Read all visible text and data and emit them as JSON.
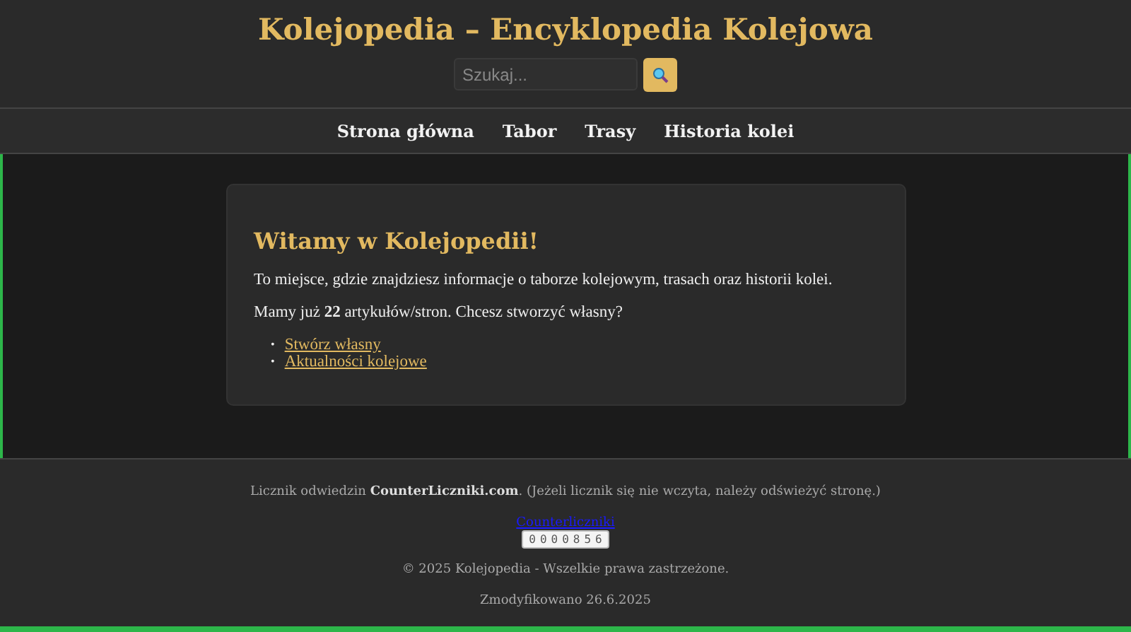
{
  "header": {
    "title": "Kolejopedia – Encyklopedia Kolejowa",
    "search": {
      "placeholder": "Szukaj..."
    }
  },
  "nav": {
    "items": [
      "Strona główna",
      "Tabor",
      "Trasy",
      "Historia kolei"
    ]
  },
  "welcome": {
    "heading": "Witamy w Kolejopedii!",
    "paragraphs": [
      "To miejsce, gdzie znajdziesz informacje o taborze kolejowym, trasach oraz historii kolei.",
      "Mamy już **22** artykułów/stron. Chcesz stworzyć własny?"
    ],
    "links": [
      {
        "marker": "•",
        "label": "Stwórz własny"
      },
      {
        "marker": "•",
        "label": "Aktualności kolejowe"
      }
    ]
  },
  "footer": {
    "counter_note": "Licznik odwiedzin **CounterLiczniki.com**. (Jeżeli licznik się nie wczyta, należy odświeżyć stronę.)",
    "counter_link": "Counterliczniki",
    "counter_value": "0000856",
    "copyright": "© 2025 Kolejopedia - Wszelkie prawa zastrzeżone.",
    "modified": "Zmodyfikowano 26.6.2025"
  }
}
